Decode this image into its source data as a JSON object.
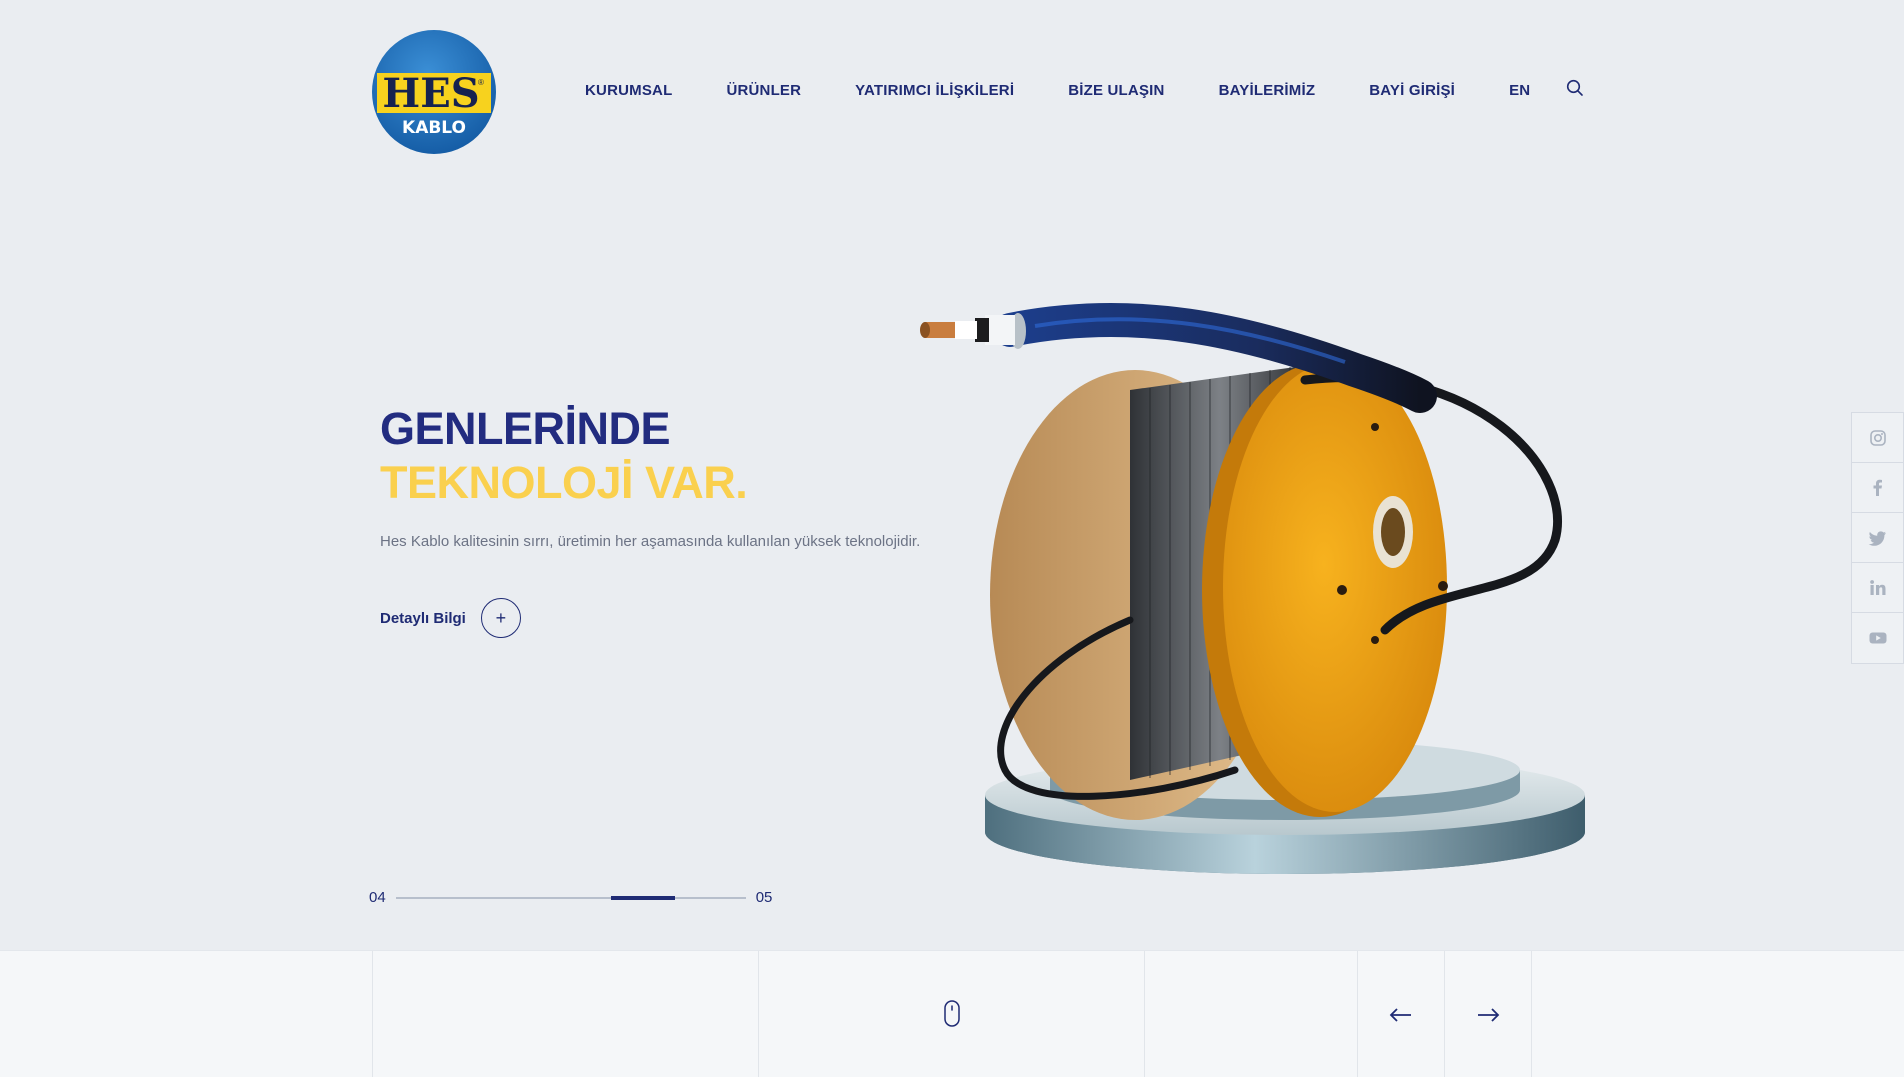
{
  "brand": {
    "logo_text_top": "HES",
    "logo_text_bottom": "KABLO",
    "colors": {
      "navy": "#1f2b74",
      "yellow": "#fad04e",
      "blue": "#1e63ae"
    }
  },
  "nav": {
    "items": [
      "KURUMSAL",
      "ÜRÜNLER",
      "YATIRIMCI İLİŞKİLERİ",
      "BİZE ULAŞIN",
      "BAYİLERİMİZ",
      "BAYİ GİRİŞİ"
    ],
    "lang": "EN",
    "search_icon": "search-icon"
  },
  "hero": {
    "title_line1": "GENLERİNDE",
    "title_line2": "TEKNOLOJİ VAR.",
    "description": "Hes Kablo kalitesinin sırrı, üretimin her aşamasında kullanılan yüksek teknolojidir.",
    "more_label": "Detaylı Bilgi",
    "more_icon": "+"
  },
  "slider": {
    "current": "04",
    "total": "05"
  },
  "social": [
    "instagram-icon",
    "facebook-icon",
    "twitter-icon",
    "linkedin-icon",
    "youtube-icon"
  ],
  "footer_controls": {
    "scroll_icon": "mouse-icon",
    "prev_icon": "arrow-left-icon",
    "next_icon": "arrow-right-icon"
  }
}
